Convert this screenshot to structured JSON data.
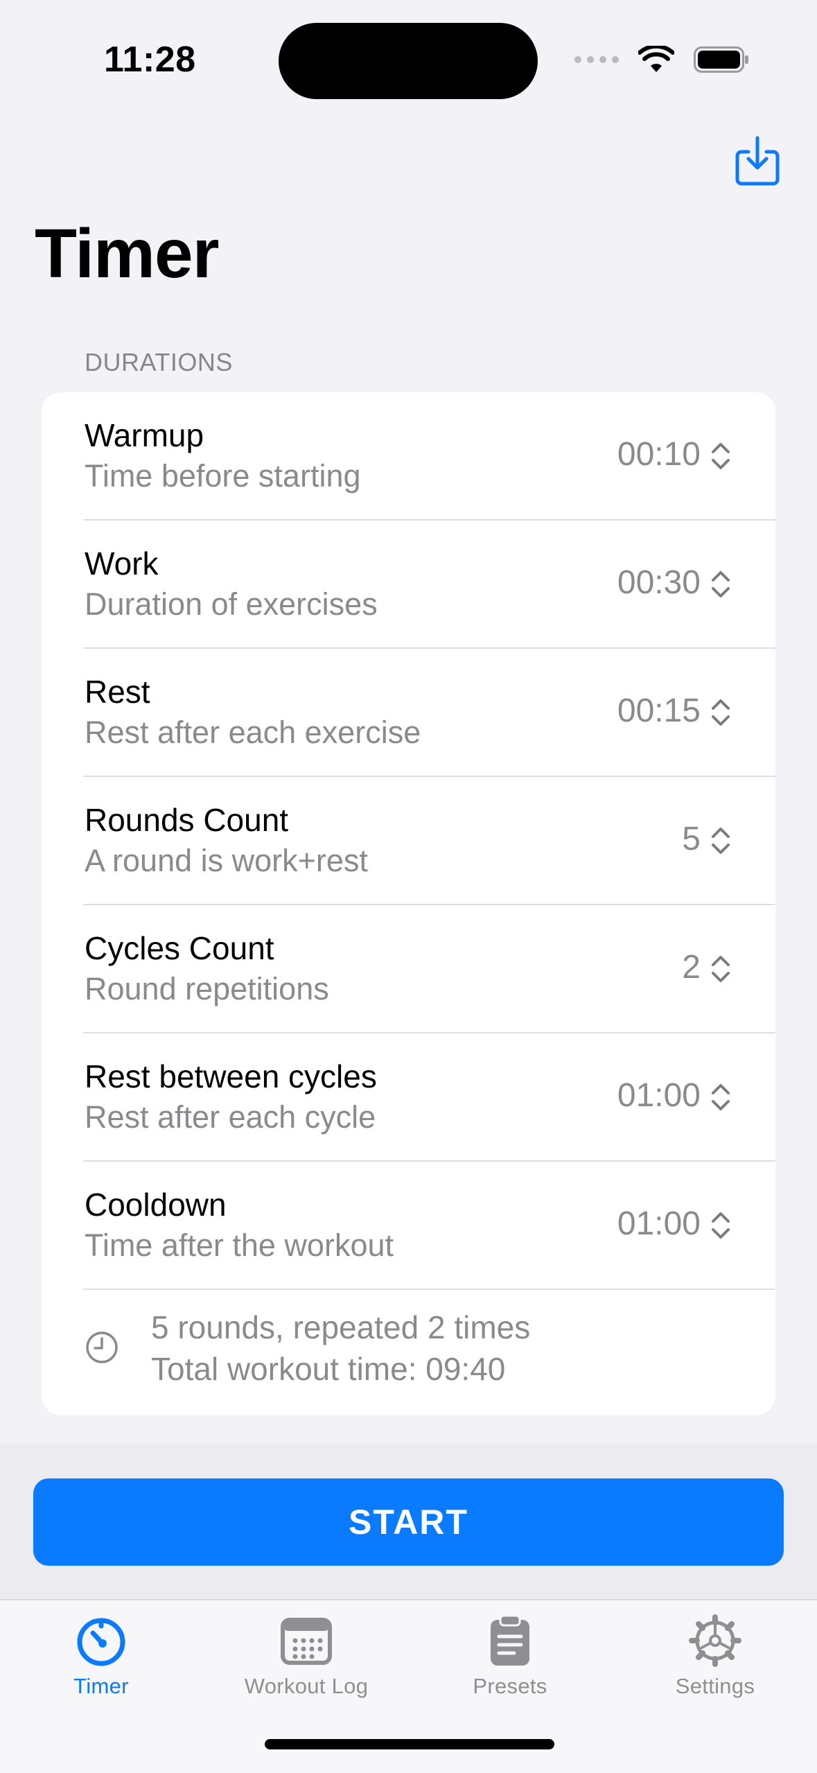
{
  "status_bar": {
    "time": "11:28"
  },
  "nav": {
    "title": "Timer"
  },
  "section": {
    "header": "DURATIONS"
  },
  "rows": [
    {
      "title": "Warmup",
      "subtitle": "Time before starting",
      "value": "00:10"
    },
    {
      "title": "Work",
      "subtitle": "Duration of exercises",
      "value": "00:30"
    },
    {
      "title": "Rest",
      "subtitle": "Rest after each exercise",
      "value": "00:15"
    },
    {
      "title": "Rounds Count",
      "subtitle": "A round is work+rest",
      "value": "5"
    },
    {
      "title": "Cycles Count",
      "subtitle": "Round repetitions",
      "value": "2"
    },
    {
      "title": "Rest between cycles",
      "subtitle": "Rest after each cycle",
      "value": "01:00"
    },
    {
      "title": "Cooldown",
      "subtitle": "Time after the workout",
      "value": "01:00"
    }
  ],
  "summary": {
    "line1": "5 rounds, repeated 2 times",
    "line2": "Total workout time: 09:40"
  },
  "start_button": {
    "label": "START"
  },
  "tabs": [
    {
      "label": "Timer",
      "icon": "timer-icon",
      "active": true
    },
    {
      "label": "Workout Log",
      "icon": "calendar-icon",
      "active": false
    },
    {
      "label": "Presets",
      "icon": "clipboard-icon",
      "active": false
    },
    {
      "label": "Settings",
      "icon": "gear-icon",
      "active": false
    }
  ],
  "colors": {
    "accent": "#0a7aff",
    "background": "#f2f2f7",
    "secondary_text": "#8a8a8e"
  }
}
